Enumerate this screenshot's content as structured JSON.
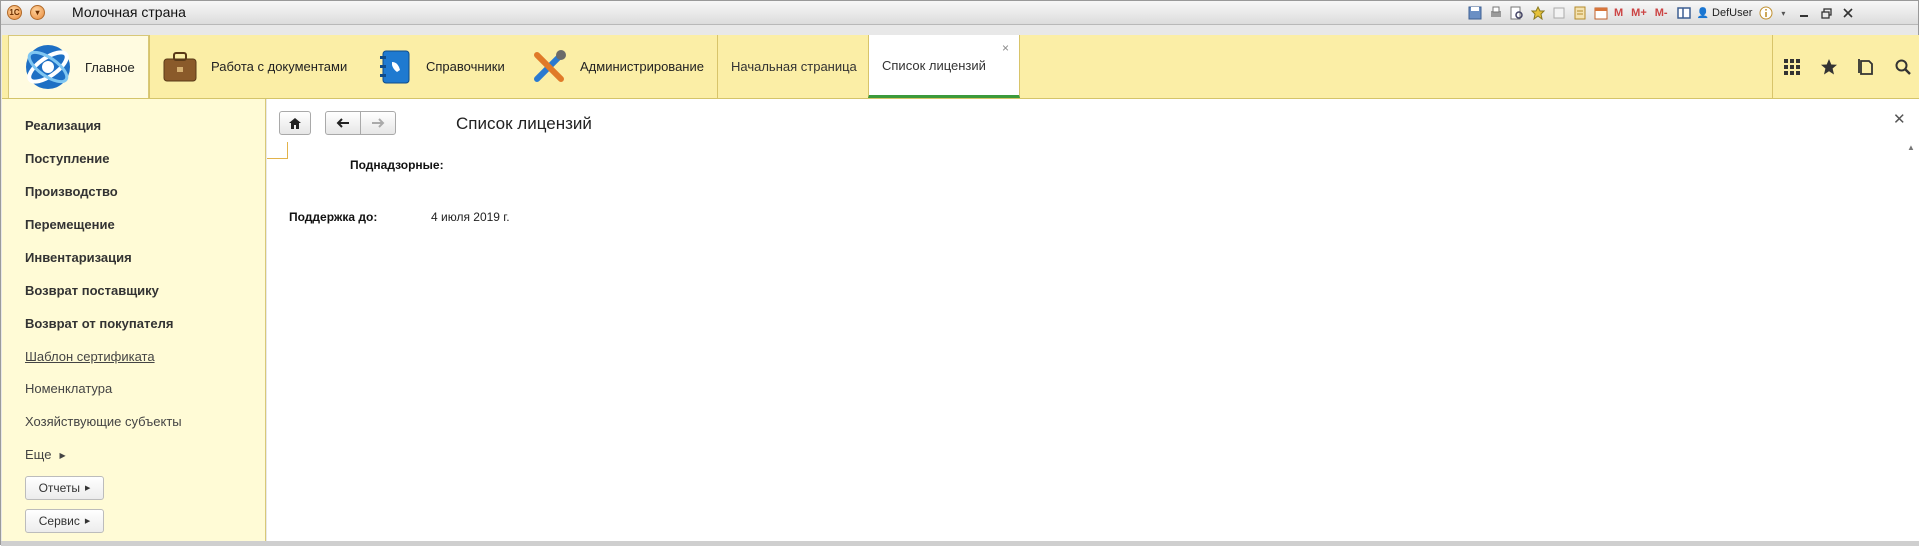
{
  "titlebar": {
    "app_title": "Молочная страна",
    "user": "DefUser",
    "mem_buttons": [
      "M",
      "M+",
      "M-"
    ],
    "window_controls": [
      "minimize",
      "restore",
      "close"
    ]
  },
  "sections": {
    "items": [
      {
        "label": "Главное",
        "icon": "app-logo-icon"
      },
      {
        "label": "Работа с документами",
        "icon": "briefcase-icon"
      },
      {
        "label": "Справочники",
        "icon": "address-book-icon"
      },
      {
        "label": "Администрирование",
        "icon": "tools-icon"
      }
    ],
    "open_tabs": [
      {
        "label": "Начальная страница",
        "active": false
      },
      {
        "label": "Список лицензий",
        "active": true
      }
    ],
    "right_tools": [
      "apps-grid-icon",
      "star-icon",
      "history-icon",
      "search-icon"
    ]
  },
  "leftnav": {
    "items": [
      {
        "label": "Реализация",
        "style": "bold"
      },
      {
        "label": "Поступление",
        "style": "bold"
      },
      {
        "label": "Производство",
        "style": "bold"
      },
      {
        "label": "Перемещение",
        "style": "bold"
      },
      {
        "label": "Инвентаризация",
        "style": "bold"
      },
      {
        "label": "Возврат поставщику",
        "style": "bold"
      },
      {
        "label": "Возврат от покупателя",
        "style": "bold"
      },
      {
        "label": "Шаблон сертификата",
        "style": "link"
      },
      {
        "label": "Номенклатура",
        "style": "plain"
      },
      {
        "label": "Хозяйствующие субъекты",
        "style": "plain"
      }
    ],
    "more_label": "Еще",
    "buttons": [
      "Отчеты",
      "Сервис"
    ]
  },
  "form": {
    "title": "Список лицензий",
    "field_supervised_label": "Поднадзорные:",
    "field_support_label": "Поддержка до:",
    "field_support_value": "4 июля 2019 г."
  },
  "colors": {
    "section_bg": "#fbeea6",
    "nav_bg": "#fffbd6",
    "active_tab_underline": "#3b9a3b"
  }
}
